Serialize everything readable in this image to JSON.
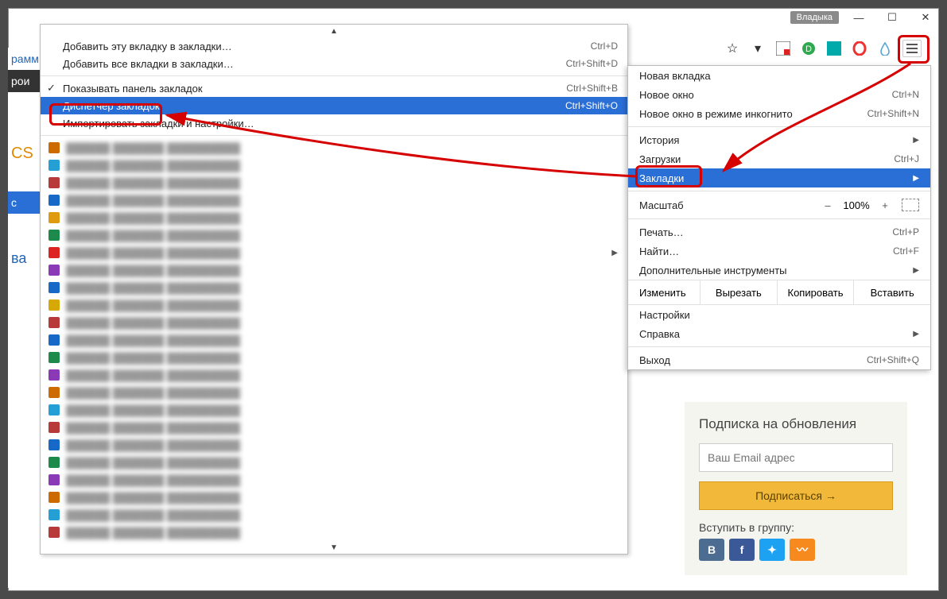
{
  "titlebar": {
    "user": "Владыка"
  },
  "ext_icons": [
    "star",
    "pocket",
    "l1",
    "green-o",
    "cyan",
    "red-o",
    "water"
  ],
  "submenu": {
    "add_this": {
      "label": "Добавить эту вкладку в закладки…",
      "shortcut": "Ctrl+D"
    },
    "add_all": {
      "label": "Добавить все вкладки в закладки…",
      "shortcut": "Ctrl+Shift+D"
    },
    "show_bar": {
      "label": "Показывать панель закладок",
      "shortcut": "Ctrl+Shift+B"
    },
    "manager": {
      "label": "Диспетчер закладок",
      "shortcut": "Ctrl+Shift+O"
    },
    "import": {
      "label": "Импортировать закладки и настройки…"
    }
  },
  "bookmarks_list": [
    {
      "fav": "#cd6a00"
    },
    {
      "fav": "#24a0d6"
    },
    {
      "fav": "#b73939"
    },
    {
      "fav": "#1669c7"
    },
    {
      "fav": "#e09a10"
    },
    {
      "fav": "#1c8a4a"
    },
    {
      "fav": "#d22",
      "folder": true
    },
    {
      "fav": "#8a39b7"
    },
    {
      "fav": "#1669c7"
    },
    {
      "fav": "#d6a900"
    },
    {
      "fav": "#b73939"
    },
    {
      "fav": "#1669c7"
    },
    {
      "fav": "#1c8a4a"
    },
    {
      "fav": "#8a39b7"
    },
    {
      "fav": "#cd6a00"
    },
    {
      "fav": "#24a0d6"
    },
    {
      "fav": "#b73939"
    },
    {
      "fav": "#1669c7"
    },
    {
      "fav": "#1c8a4a"
    },
    {
      "fav": "#8a39b7"
    },
    {
      "fav": "#cd6a00"
    },
    {
      "fav": "#24a0d6"
    },
    {
      "fav": "#b73939"
    }
  ],
  "mainmenu": {
    "new_tab": {
      "label": "Новая вкладка"
    },
    "new_win": {
      "label": "Новое окно",
      "shortcut": "Ctrl+N"
    },
    "incognito": {
      "label": "Новое окно в режиме инкогнито",
      "shortcut": "Ctrl+Shift+N"
    },
    "history": {
      "label": "История"
    },
    "downloads": {
      "label": "Загрузки",
      "shortcut": "Ctrl+J"
    },
    "bookmarks": {
      "label": "Закладки"
    },
    "zoom": {
      "label": "Масштаб",
      "value": "100%"
    },
    "print": {
      "label": "Печать…",
      "shortcut": "Ctrl+P"
    },
    "find": {
      "label": "Найти…",
      "shortcut": "Ctrl+F"
    },
    "tools": {
      "label": "Дополнительные инструменты"
    },
    "edit": {
      "label": "Изменить",
      "cut": "Вырезать",
      "copy": "Копировать",
      "paste": "Вставить"
    },
    "settings": {
      "label": "Настройки"
    },
    "help": {
      "label": "Справка"
    },
    "exit": {
      "label": "Выход",
      "shortcut": "Ctrl+Shift+Q"
    }
  },
  "left_strip": {
    "a": "рамм",
    "b": "рои",
    "c": "CS",
    "d": "с",
    "e": "ва"
  },
  "subscribe": {
    "title": "Подписка на обновления",
    "placeholder": "Ваш Email адрес",
    "button": "Подписаться →",
    "groups": "Вступить в группу:"
  }
}
